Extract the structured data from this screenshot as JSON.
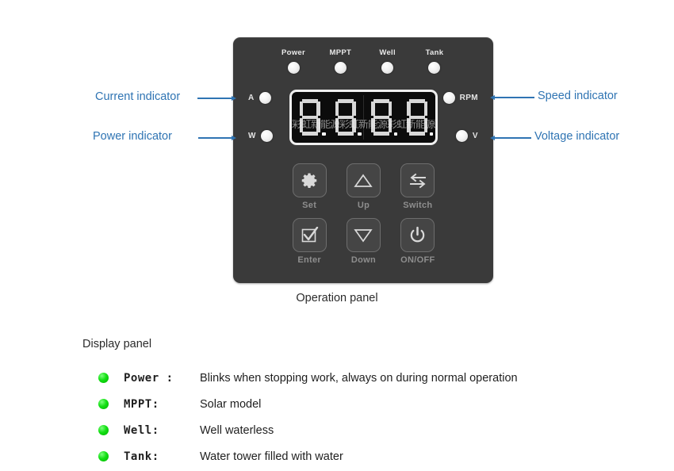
{
  "panel": {
    "caption": "Operation panel",
    "status_leds": [
      {
        "label": "Power",
        "icon": "led-icon"
      },
      {
        "label": "MPPT",
        "icon": "led-icon"
      },
      {
        "label": "Well",
        "icon": "led-icon"
      },
      {
        "label": "Tank",
        "icon": "led-icon"
      }
    ],
    "units": {
      "current": "A",
      "power": "W",
      "speed": "RPM",
      "voltage": "V"
    },
    "display": {
      "digits": [
        "8",
        "8",
        "8",
        "8"
      ],
      "decimal_points": [
        true,
        true,
        true,
        true
      ],
      "value": "8888"
    },
    "keys": [
      {
        "label": "Set",
        "icon": "gear-icon"
      },
      {
        "label": "Up",
        "icon": "triangle-up-icon"
      },
      {
        "label": "Switch",
        "icon": "swap-arrows-icon"
      },
      {
        "label": "Enter",
        "icon": "checkbox-check-icon"
      },
      {
        "label": "Down",
        "icon": "triangle-down-icon"
      },
      {
        "label": "ON/OFF",
        "icon": "power-icon"
      }
    ]
  },
  "callouts": {
    "current": "Current indicator",
    "power": "Power indicator",
    "speed": "Speed indicator",
    "voltage": "Voltage indicator"
  },
  "display_section": {
    "title": "Display panel",
    "rows": [
      {
        "key": "Power :",
        "desc": "Blinks when stopping work, always on during normal operation"
      },
      {
        "key": "MPPT:",
        "desc": "Solar model"
      },
      {
        "key": "Well:",
        "desc": "Well waterless"
      },
      {
        "key": "Tank:",
        "desc": "Water tower filled with water"
      }
    ]
  },
  "colors": {
    "callout_blue": "#2f74b3",
    "panel_body": "#3a3a3a",
    "led_green": "#14e014",
    "segment_on": "#d8d8d8",
    "text_dark": "#1f1f1f"
  },
  "watermark": {
    "text": "彩虹新能源彩虹新能源彩虹新能源彩虹新能源彩虹新能源"
  }
}
